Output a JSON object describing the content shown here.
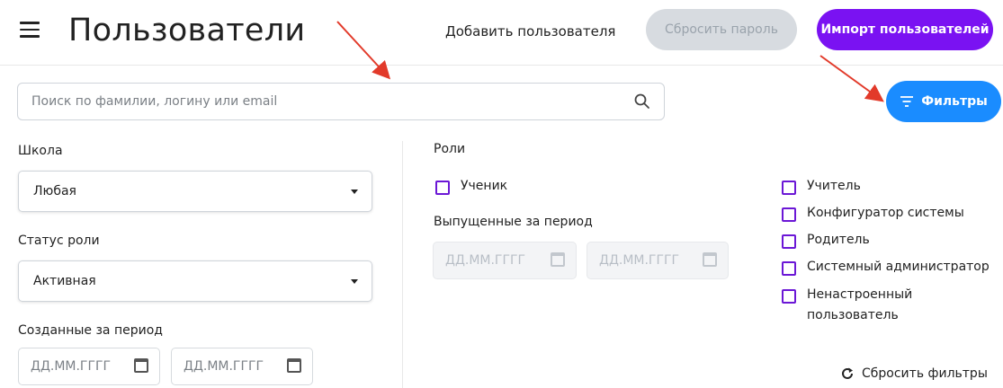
{
  "header": {
    "title": "Пользователи",
    "add_user": "Добавить пользователя",
    "reset_password": "Сбросить пароль",
    "import_users": "Импорт пользователей"
  },
  "search": {
    "placeholder": "Поиск по фамилии, логину или email"
  },
  "filter_button": "Фильтры",
  "filters": {
    "school": {
      "label": "Школа",
      "value": "Любая"
    },
    "role_status": {
      "label": "Статус роли",
      "value": "Активная"
    },
    "created_period": {
      "label": "Созданные за период",
      "from_placeholder": "ДД.ММ.ГГГГ",
      "to_placeholder": "ДД.ММ.ГГГГ"
    },
    "roles": {
      "label": "Роли",
      "student": "Ученик",
      "teacher": "Учитель",
      "sys_configurator": "Конфигуратор системы",
      "parent": "Родитель",
      "sys_admin": "Системный администратор",
      "unconfigured_1": "Ненастроенный",
      "unconfigured_2": "пользователь"
    },
    "issued_period": {
      "label": "Выпущенные за период",
      "from_placeholder": "ДД.ММ.ГГГГ",
      "to_placeholder": "ДД.ММ.ГГГГ"
    },
    "reset_label": "Сбросить фильтры"
  },
  "colors": {
    "primary": "#7a12f2",
    "accent": "#1a8cff",
    "annotation_arrow": "#e23a2a"
  }
}
